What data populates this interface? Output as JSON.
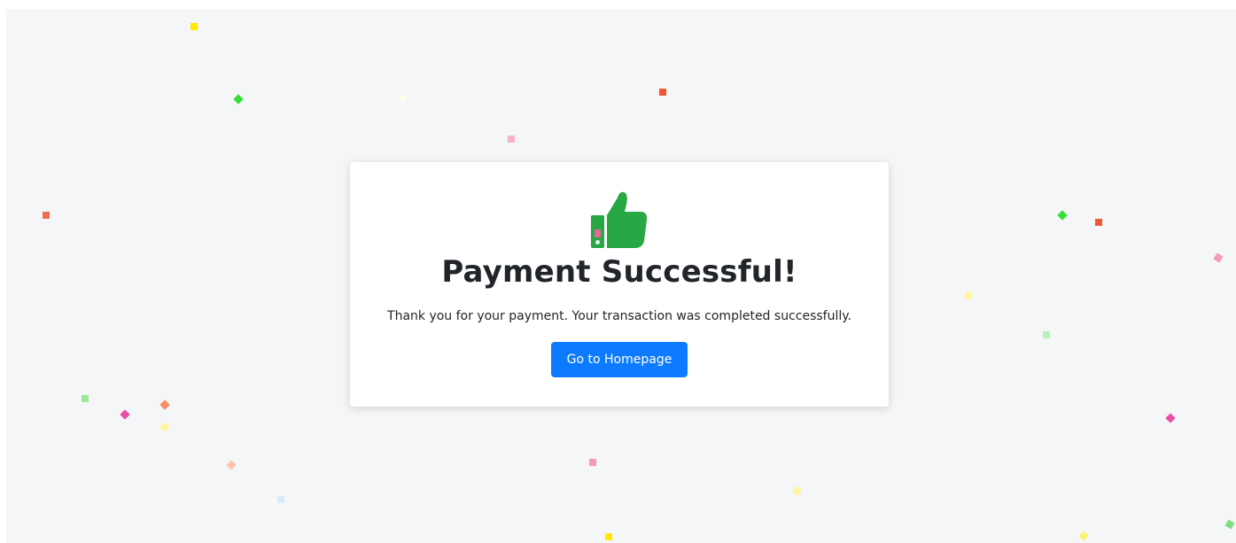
{
  "card": {
    "icon": "thumbs-up-icon",
    "title": "Payment Successful!",
    "message": "Thank you for your payment. Your transaction was completed successfully.",
    "button_label": "Go to Homepage"
  },
  "colors": {
    "background": "#f5f6f8",
    "card": "#ffffff",
    "accent": "#0d7bff",
    "icon": "#28a745",
    "text": "#212529"
  },
  "confetti_colors": [
    "#ffea00",
    "#33e033",
    "#f0592f",
    "#f29ab8",
    "#7fe07f",
    "#fff59d",
    "#ff8a65",
    "#e94fa3",
    "#bbdefb"
  ]
}
